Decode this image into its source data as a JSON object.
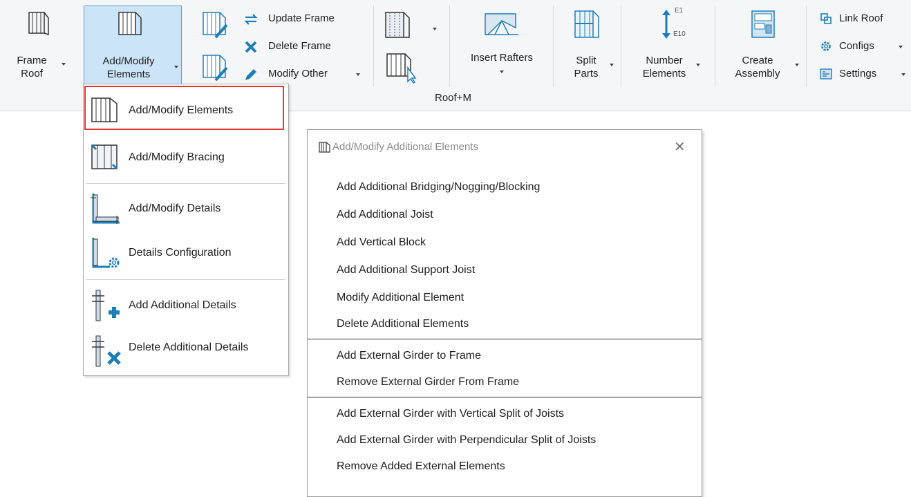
{
  "ribbon": {
    "frame_roof": {
      "line1": "Frame",
      "line2": "Roof"
    },
    "add_modify": {
      "line1": "Add/Modify",
      "line2": "Elements"
    },
    "update_frame": "Update Frame",
    "delete_frame": "Delete Frame",
    "modify_other": "Modify Other",
    "insert_rafters": "Insert Rafters",
    "split_parts": {
      "line1": "Split",
      "line2": "Parts"
    },
    "number_elements": {
      "line1": "Number",
      "line2": "Elements",
      "e1": "E1",
      "e10": "E10"
    },
    "create_assembly": {
      "line1": "Create",
      "line2": "Assembly"
    },
    "link_roof": "Link Roof",
    "configs": "Configs",
    "settings": "Settings",
    "group_title": "Roof+M"
  },
  "dropdown": {
    "items": [
      "Add/Modify  Elements",
      "Add/Modify  Bracing",
      "Add/Modify  Details",
      "Details  Configuration",
      "Add Additional  Details",
      "Delete Additional  Details"
    ]
  },
  "panel": {
    "title": "Add/Modify Additional Elements",
    "close": "✕",
    "items": [
      "Add Additional Bridging/Nogging/Blocking",
      "Add Additional Joist",
      "Add Vertical Block",
      "Add Additional Support Joist",
      "Modify Additional Element",
      "Delete Additional Elements",
      "Add External Girder to Frame",
      "Remove External Girder From Frame",
      "Add External Girder with Vertical Split of Joists",
      "Add External Girder with Perpendicular Split of Joists",
      "Remove Added External Elements"
    ]
  },
  "colors": {
    "accent": "#1e7fb8",
    "highlight": "#e53935",
    "selected_bg": "#cce4f7",
    "selected_border": "#5b9bd5"
  }
}
